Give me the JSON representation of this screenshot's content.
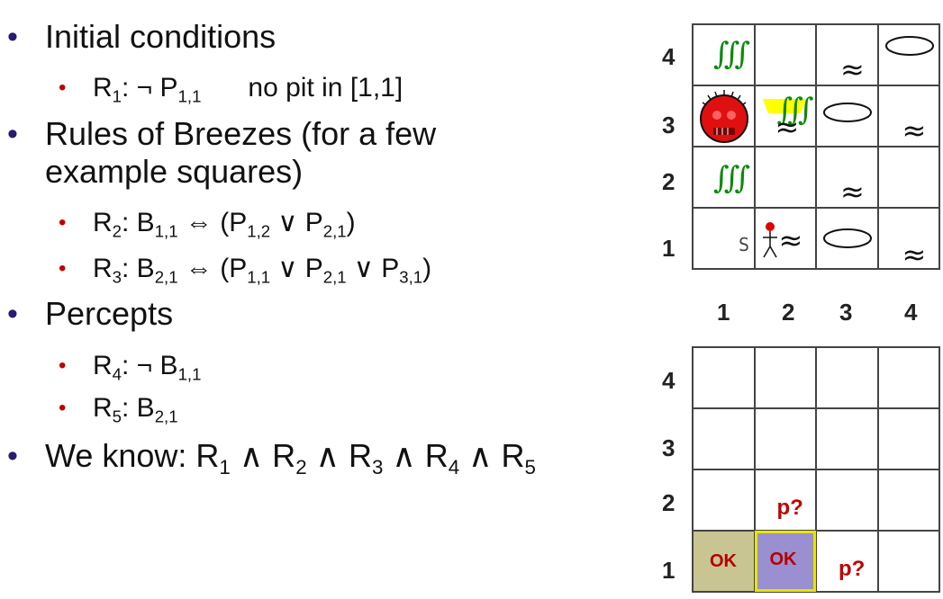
{
  "slide": {
    "bullets": [
      {
        "text": "Initial conditions"
      },
      {
        "text_prefix": "R",
        "sub1": "1",
        "body": ": ¬ P",
        "sub2": "1,1",
        "note": "no pit in [1,1]"
      },
      {
        "text_line1": "Rules of Breezes (for a few",
        "text_line2": "example squares)"
      },
      {
        "label": "R",
        "lsub": "2",
        "body": ": B",
        "bsub": "1,1",
        "eq": " ⇔ (P",
        "p1sub": "1,2",
        "or": " ∨ P",
        "p2sub": "2,1",
        "end": ")"
      },
      {
        "label": "R",
        "lsub": "3",
        "body": ": B",
        "bsub": "2,1",
        "eq": " ⇔ (P",
        "p1sub": "1,1",
        "or1": " ∨ P",
        "p2sub": "2,1",
        "or2": " ∨ P",
        "p3sub": "3,1",
        "end": ")"
      },
      {
        "text": "Percepts"
      },
      {
        "label": "R",
        "lsub": "4",
        "body": ": ¬ B",
        "bsub": "1,1"
      },
      {
        "label": "R",
        "lsub": "5",
        "body": ": B",
        "bsub": "2,1"
      },
      {
        "prefix": "We know: R",
        "s1": "1",
        "a1": " ∧ R",
        "s2": "2",
        "a2": " ∧ R",
        "s3": "3",
        "a3": " ∧ R",
        "s4": "4",
        "a4": " ∧ R",
        "s5": "5"
      }
    ]
  },
  "world_grid": {
    "row_labels": [
      "4",
      "3",
      "2",
      "1"
    ],
    "col_labels": [
      "1",
      "2",
      "3",
      "4"
    ],
    "stench_symbol": "∫∫∫",
    "breeze_symbol": "≈",
    "start_label": "S"
  },
  "knowledge_grid": {
    "row_labels": [
      "4",
      "3",
      "2",
      "1"
    ],
    "ok_label": "OK",
    "pit_question": "p?",
    "colors": {
      "visited": "#c9c593",
      "current": "#9a8fd0",
      "current_border": "#e6e600"
    }
  }
}
